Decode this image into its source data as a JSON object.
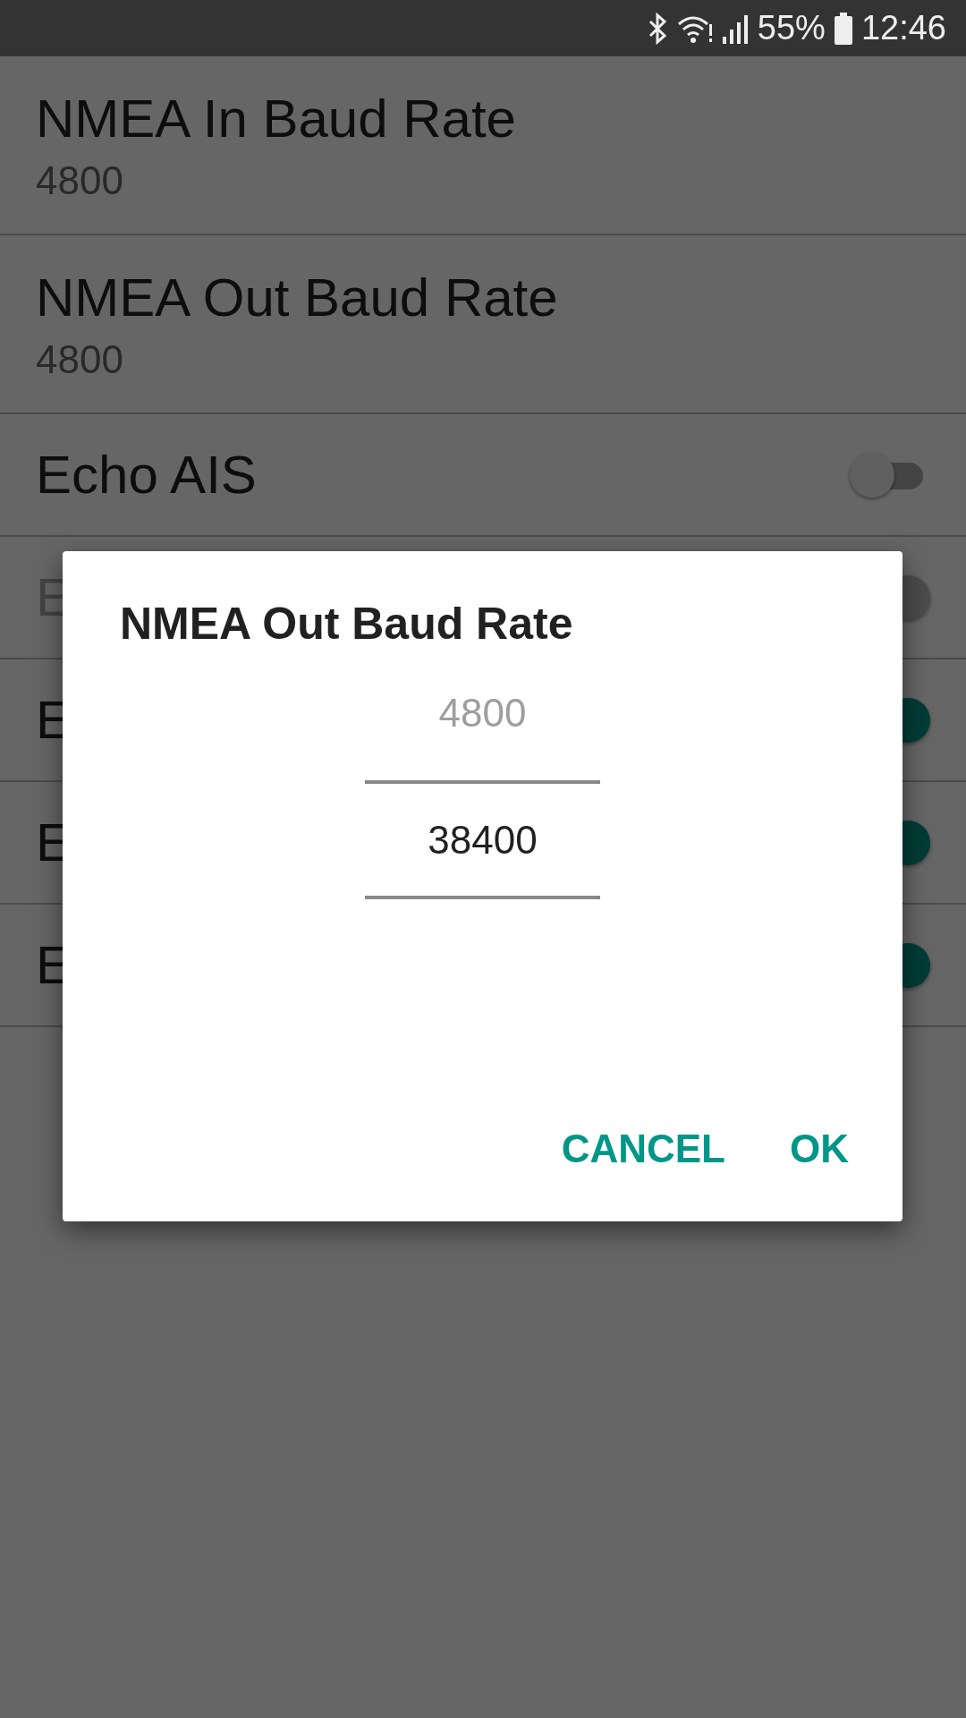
{
  "status_bar": {
    "battery_percent": "55%",
    "time": "12:46"
  },
  "settings": [
    {
      "kind": "value",
      "title": "NMEA In Baud Rate",
      "summary": "4800"
    },
    {
      "kind": "value",
      "title": "NMEA Out Baud Rate",
      "summary": "4800"
    },
    {
      "kind": "switch",
      "title": "Echo AIS",
      "checked": false,
      "disabled": false
    },
    {
      "kind": "switch",
      "title": "E",
      "checked": true,
      "disabled": true
    },
    {
      "kind": "switch",
      "title": "E",
      "checked": true,
      "disabled": false
    },
    {
      "kind": "switch",
      "title": "E",
      "checked": true,
      "disabled": false
    },
    {
      "kind": "switch",
      "title": "E",
      "checked": true,
      "disabled": false
    }
  ],
  "dialog": {
    "title": "NMEA Out Baud Rate",
    "picker": [
      {
        "value": "4800",
        "selected": false
      },
      {
        "value": "38400",
        "selected": true
      }
    ],
    "buttons": [
      "CANCEL",
      "OK"
    ]
  }
}
